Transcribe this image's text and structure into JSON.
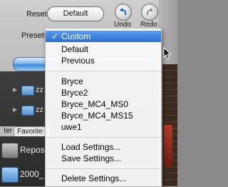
{
  "toolbar": {
    "reset_label": "Reset:",
    "reset_button": "Default",
    "undo_label": "Undo",
    "redo_label": "Redo",
    "presets_label": "Presets"
  },
  "background": {
    "folders": [
      "zz",
      "zz"
    ],
    "tabs": [
      "ter",
      "Favorite"
    ],
    "items": [
      "Reposi",
      "2000_"
    ]
  },
  "menu": {
    "check_mark": "✓",
    "groups": [
      [
        "Custom",
        "Default",
        "Previous"
      ],
      [
        "Bryce",
        "Bryce2",
        "Bryce_MC4_MS0",
        "Bryce_MC4_MS15",
        "uwe1"
      ],
      [
        "Load Settings...",
        "Save Settings..."
      ],
      [
        "Delete Settings..."
      ]
    ],
    "selected": "Custom"
  },
  "colors": {
    "highlight": "#2a6fd3",
    "aqua": "#3a8ade"
  }
}
